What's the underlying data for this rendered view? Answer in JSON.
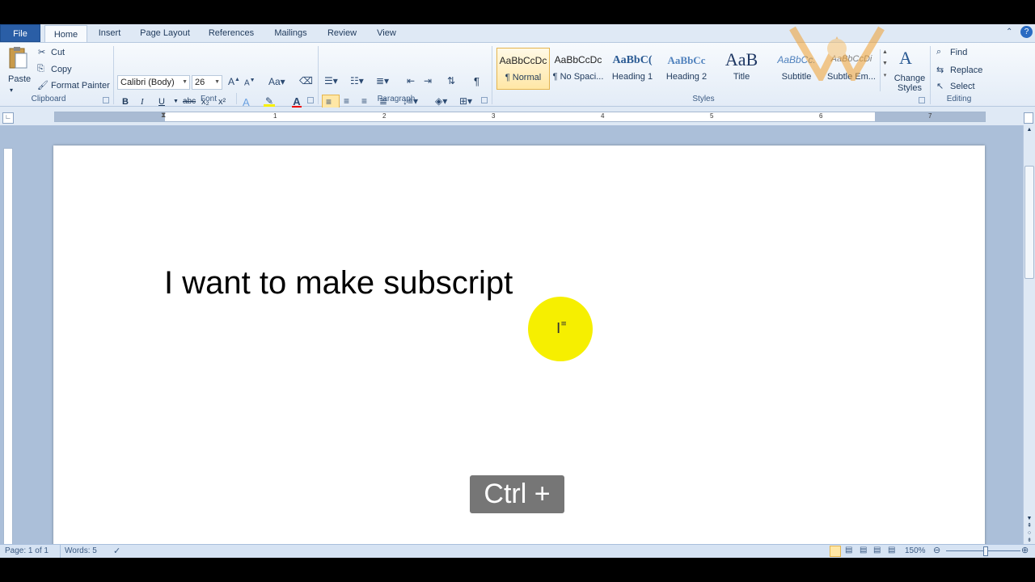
{
  "tabs": [
    "File",
    "Home",
    "Insert",
    "Page Layout",
    "References",
    "Mailings",
    "Review",
    "View"
  ],
  "active_tab": "Home",
  "clipboard": {
    "paste": "Paste",
    "cut": "Cut",
    "copy": "Copy",
    "format_painter": "Format Painter",
    "group_label": "Clipboard"
  },
  "font": {
    "family": "Calibri (Body)",
    "size": "26",
    "group_label": "Font",
    "buttons": [
      "B",
      "I",
      "U",
      "abc",
      "x₂",
      "x²"
    ]
  },
  "paragraph": {
    "group_label": "Paragraph",
    "pilcrow": "¶"
  },
  "styles": {
    "group_label": "Styles",
    "items": [
      {
        "sample": "AaBbCcDc",
        "name": "¶ Normal"
      },
      {
        "sample": "AaBbCcDc",
        "name": "¶ No Spaci..."
      },
      {
        "sample": "AaBbC(",
        "name": "Heading 1"
      },
      {
        "sample": "AaBbCc",
        "name": "Heading 2"
      },
      {
        "sample": "AaB",
        "name": "Title"
      },
      {
        "sample": "AaBbCc.",
        "name": "Subtitle"
      },
      {
        "sample": "AaBbCcDi",
        "name": "Subtle Em..."
      }
    ],
    "change_styles": "Change Styles"
  },
  "editing": {
    "group_label": "Editing",
    "find": "Find",
    "replace": "Replace",
    "select": "Select"
  },
  "ruler_numbers": [
    "1",
    "2",
    "3",
    "4",
    "5",
    "6",
    "7"
  ],
  "document": {
    "text": "I want to make subscript"
  },
  "status": {
    "page": "Page: 1 of 1",
    "words": "Words: 5",
    "zoom": "150%"
  },
  "overlay": {
    "shortcut": "Ctrl +"
  },
  "colors": {
    "file_tab": "#2a5ea6",
    "ribbon_bg": "#f7fafd",
    "workspace_bg": "#abbfd9",
    "cursor_highlight": "#f6ef00",
    "overlay_bg": "#767676"
  }
}
